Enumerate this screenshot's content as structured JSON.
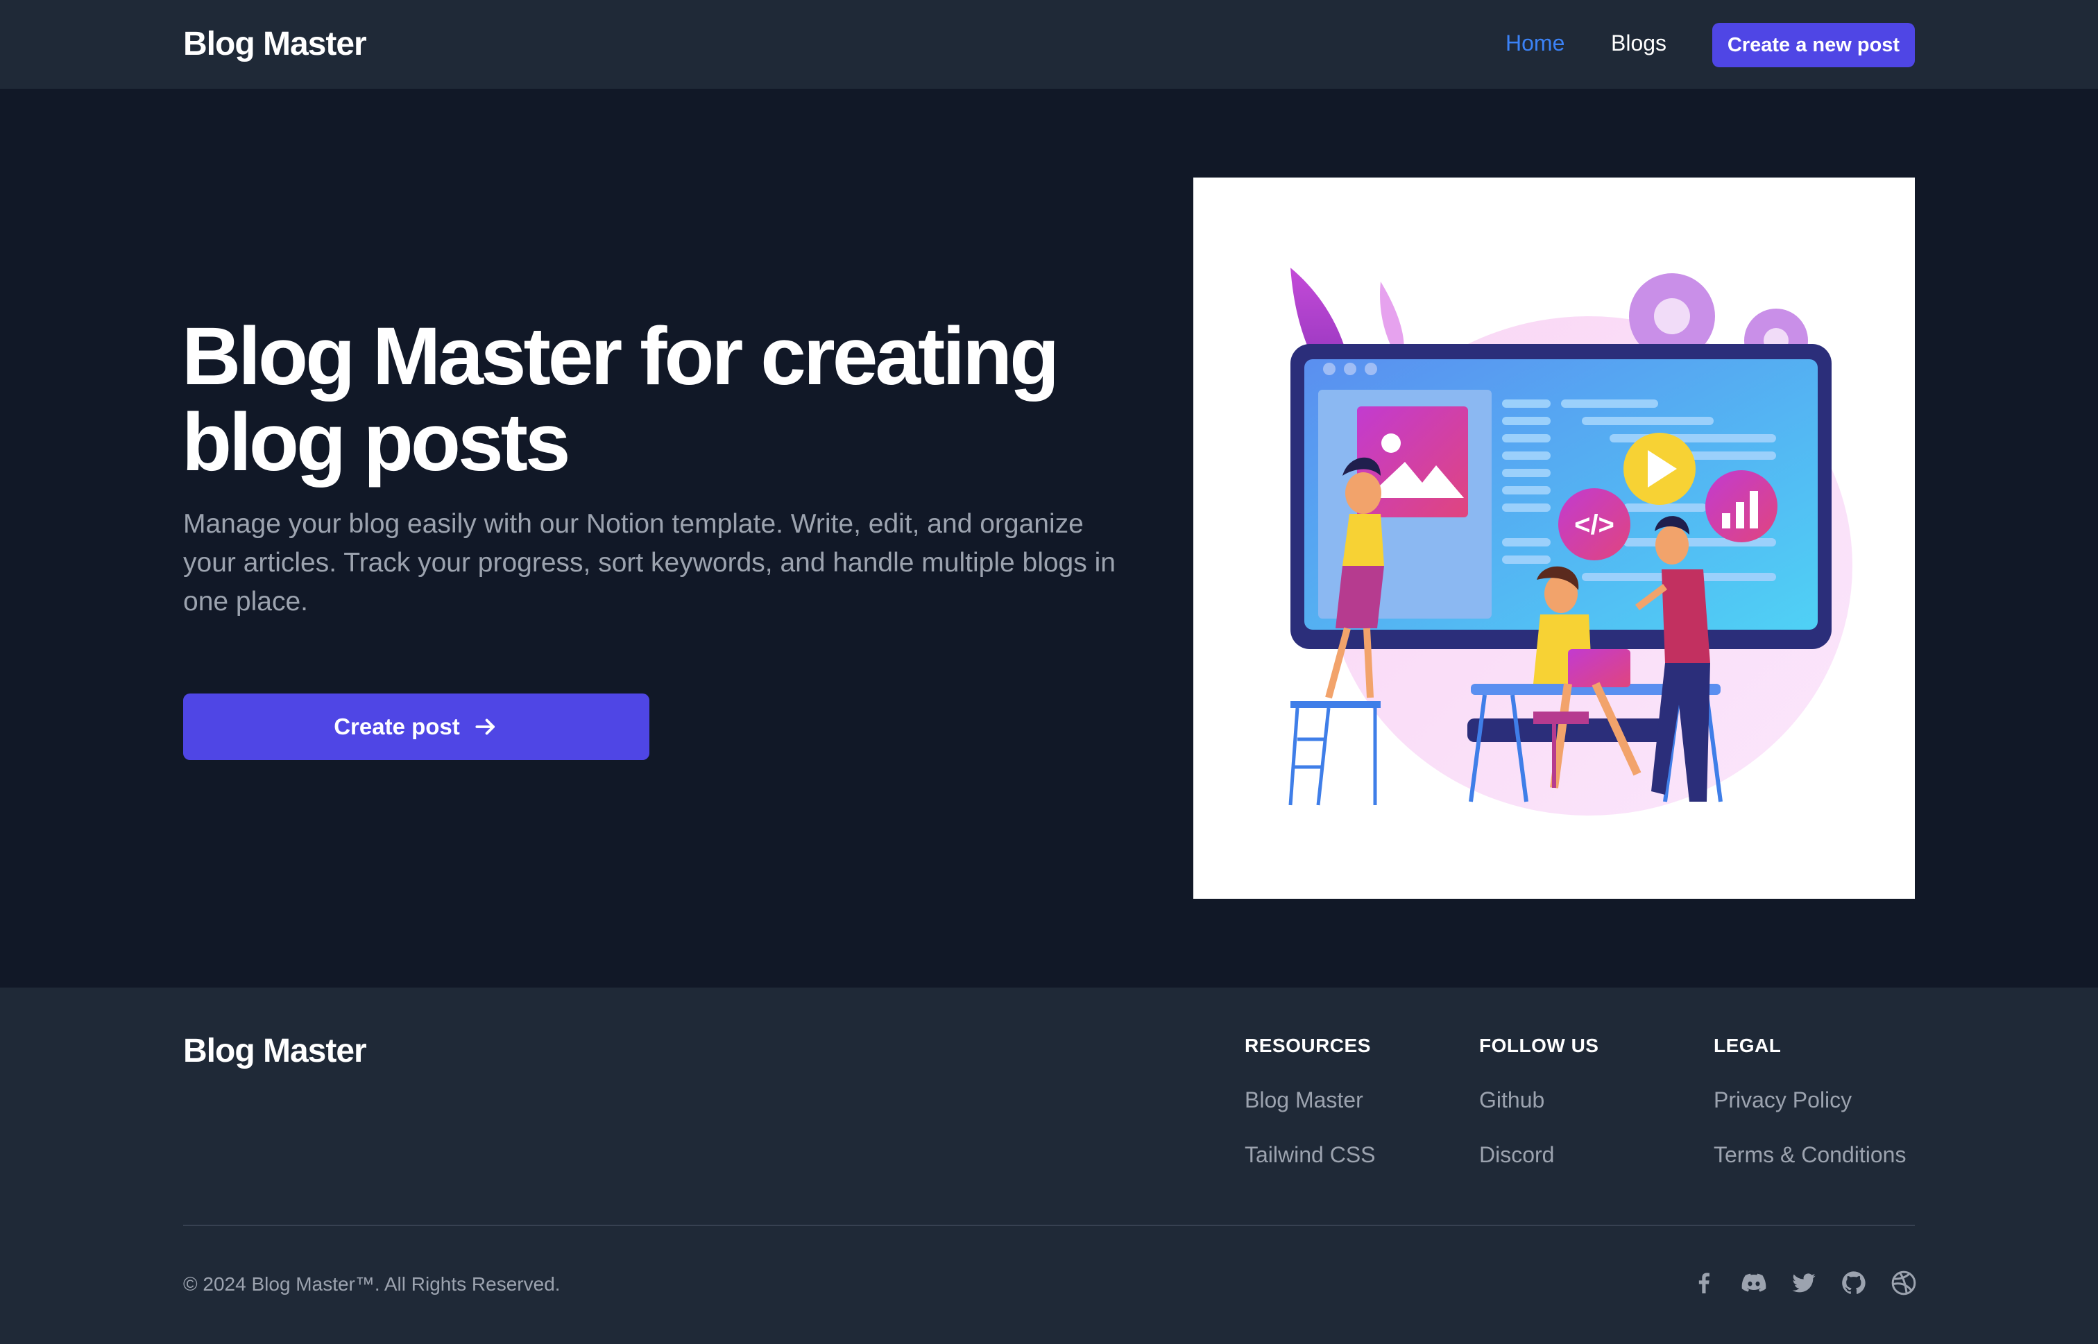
{
  "navbar": {
    "brand": "Blog Master",
    "links": [
      {
        "label": "Home",
        "active": true
      },
      {
        "label": "Blogs",
        "active": false
      }
    ],
    "cta_label": "Create a new post"
  },
  "hero": {
    "title": "Blog Master for creating blog posts",
    "description": "Manage your blog easily with our Notion template. Write, edit, and organize your articles. Track your progress, sort keywords, and handle multiple blogs in one place.",
    "button_label": "Create post",
    "button_icon": "arrow-right-icon"
  },
  "footer": {
    "brand": "Blog Master",
    "columns": [
      {
        "title": "RESOURCES",
        "links": [
          "Blog Master",
          "Tailwind CSS"
        ]
      },
      {
        "title": "FOLLOW US",
        "links": [
          "Github",
          "Discord"
        ]
      },
      {
        "title": "LEGAL",
        "links": [
          "Privacy Policy",
          "Terms & Conditions"
        ]
      }
    ],
    "copyright": "© 2024 Blog Master™. All Rights Reserved.",
    "social_icons": [
      "facebook-icon",
      "discord-icon",
      "twitter-icon",
      "github-icon",
      "dribbble-icon"
    ]
  },
  "colors": {
    "background": "#111827",
    "surface": "#1f2937",
    "accent": "#4f46e5",
    "link_active": "#3b82f6",
    "muted_text": "#9ca3af"
  }
}
